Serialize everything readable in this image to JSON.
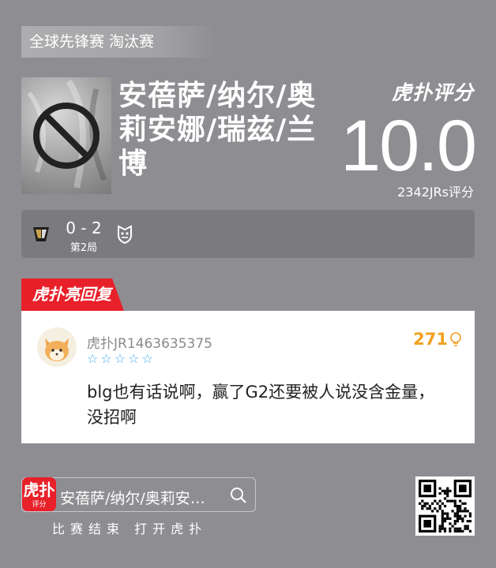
{
  "stage": "全球先锋赛 淘汰赛",
  "hero": {
    "name": "安蓓萨/纳尔/奥莉安娜/瑞兹/兰博",
    "image_icon": "prohibited-icon"
  },
  "rating": {
    "brand": "虎扑评分",
    "score": "10.0",
    "count_text": "2342JRs评分"
  },
  "match": {
    "left_team_icon": "team-logo",
    "score": "0 - 2",
    "game": "第2局",
    "right_team_icon": "g2-logo"
  },
  "reply": {
    "tag": "虎扑亮回复",
    "user": "虎扑JR1463635375",
    "stars": "☆☆☆☆☆",
    "likes": "271",
    "text": "blg也有话说啊，赢了G2还要被人说没含金量，没招啊"
  },
  "footer": {
    "app_icon_big": "虎扑",
    "app_icon_small": "评分",
    "search_text": "安蓓萨/纳尔/奥莉安…",
    "caption": "比赛结束 打开虎扑"
  },
  "colors": {
    "background": "#8e8e92",
    "accent_red": "#e8202a",
    "likes_orange": "#f0a020",
    "star_blue": "#3fa9f5"
  }
}
